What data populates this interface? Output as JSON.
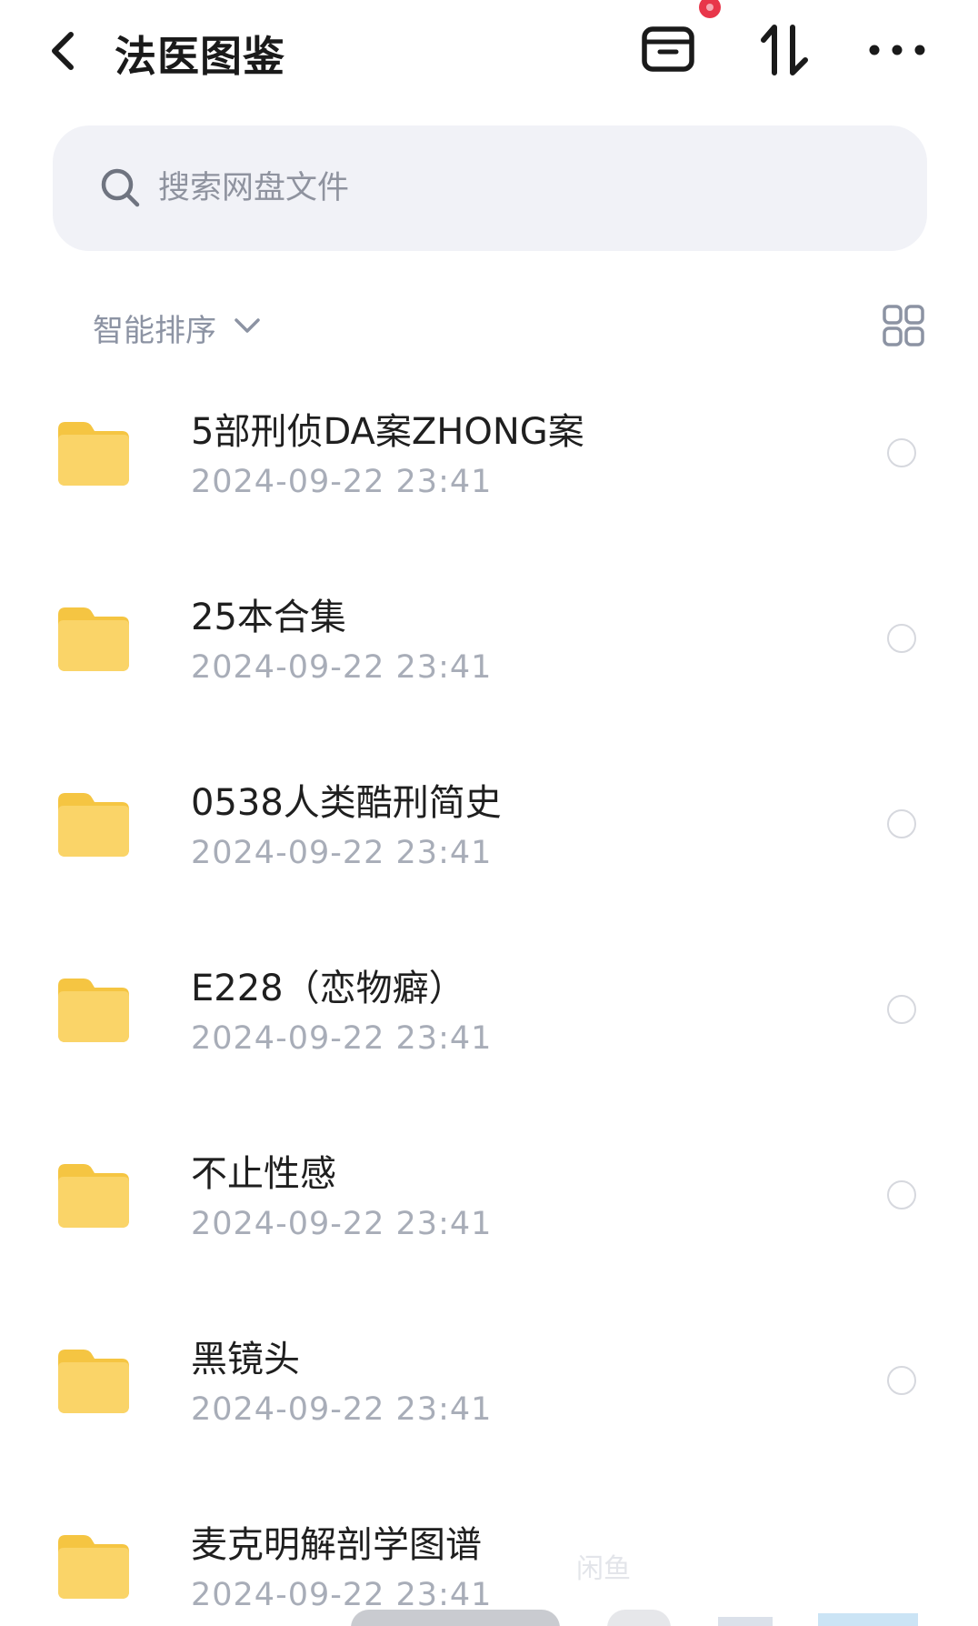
{
  "header": {
    "title": "法医图鉴"
  },
  "search": {
    "placeholder": "搜索网盘文件"
  },
  "sort": {
    "label": "智能排序"
  },
  "files": [
    {
      "name": "5部刑侦DA案ZHONG案",
      "date": "2024-09-22  23:41"
    },
    {
      "name": "25本合集",
      "date": "2024-09-22  23:41"
    },
    {
      "name": "0538人类酷刑简史",
      "date": "2024-09-22  23:41"
    },
    {
      "name": "E228（恋物癖）",
      "date": "2024-09-22  23:41"
    },
    {
      "name": "不止性感",
      "date": "2024-09-22  23:41"
    },
    {
      "name": "黑镜头",
      "date": "2024-09-22  23:41"
    },
    {
      "name": "麦克明解剖学图谱",
      "date": "2024-09-22  23:41"
    }
  ],
  "watermark": "闲鱼",
  "colors": {
    "folder": "#f7c948",
    "badge": "#e8364a",
    "search_bg": "#f1f2f7",
    "secondary_text": "#a8adb8"
  },
  "icons": [
    "back-icon",
    "archive-icon",
    "sort-icon",
    "more-icon",
    "search-icon",
    "chevron-down-icon",
    "grid-view-icon",
    "folder-icon"
  ]
}
